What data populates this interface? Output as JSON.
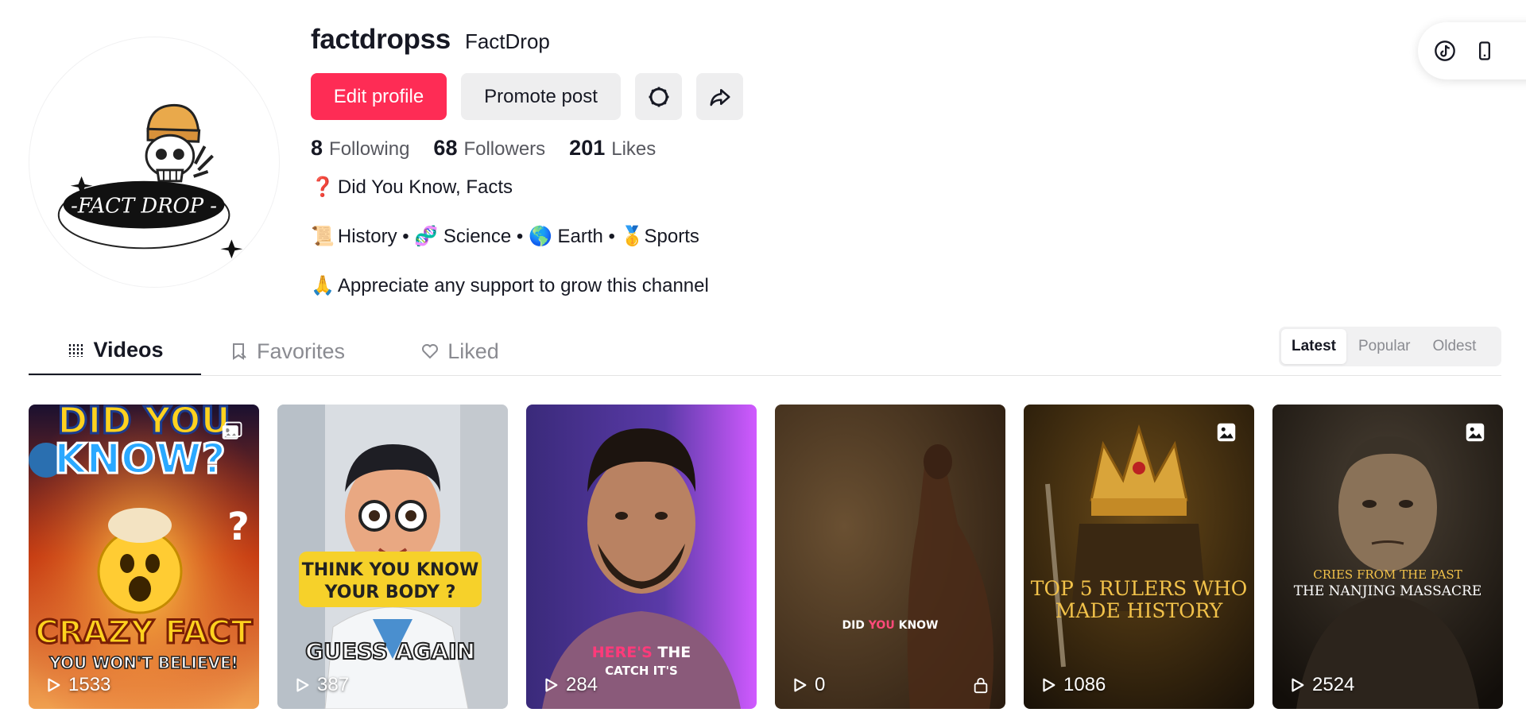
{
  "profile": {
    "username": "factdropss",
    "nickname": "FactDrop",
    "avatar_text": "-FACT DROP -"
  },
  "buttons": {
    "edit_profile": "Edit profile",
    "promote_post": "Promote post",
    "settings_icon": "gear-icon",
    "share_icon": "share-icon"
  },
  "stats": [
    {
      "value": "8",
      "label": "Following"
    },
    {
      "value": "68",
      "label": "Followers"
    },
    {
      "value": "201",
      "label": "Likes"
    }
  ],
  "bio": [
    {
      "emoji": "❓",
      "text": "Did You Know, Facts"
    },
    {
      "emoji": "📜",
      "text": "History • 🧬 Science • 🌎 Earth • 🥇Sports"
    },
    {
      "emoji": "🙏",
      "text": "Appreciate any support to grow this channel"
    }
  ],
  "tabs": [
    {
      "label": "Videos",
      "active": true,
      "icon": "grid-icon"
    },
    {
      "label": "Favorites",
      "active": false,
      "icon": "bookmark-icon"
    },
    {
      "label": "Liked",
      "active": false,
      "icon": "heart-icon"
    }
  ],
  "sort": [
    "Latest",
    "Popular",
    "Oldest"
  ],
  "sort_active": "Latest",
  "videos": [
    {
      "views": "1533",
      "title_top": "DID YOU KNOW?",
      "title_bottom": "CRAZY FACT",
      "subtitle": "YOU WON'T BELIEVE!",
      "type": "photo"
    },
    {
      "views": "387",
      "caption1": "THINK YOU KNOW",
      "caption2": "YOUR BODY ?",
      "caption3": "GUESS AGAIN",
      "type": "video"
    },
    {
      "views": "284",
      "caption1": "HERE'S",
      "caption1b": "THE",
      "caption2": "CATCH IT'S",
      "type": "video"
    },
    {
      "views": "0",
      "caption1": "DID",
      "caption1b": "YOU",
      "caption1c": "KNOW",
      "type": "private"
    },
    {
      "views": "1086",
      "caption1": "TOP 5 RULERS WHO",
      "caption2": "MADE HISTORY",
      "type": "photo"
    },
    {
      "views": "2524",
      "caption1": "CRIES FROM THE PAST",
      "caption2": "THE NANJING MASSACRE",
      "type": "photo"
    }
  ],
  "colors": {
    "accent": "#fe2c55",
    "text": "#161823",
    "muted": "#8a8b91"
  }
}
